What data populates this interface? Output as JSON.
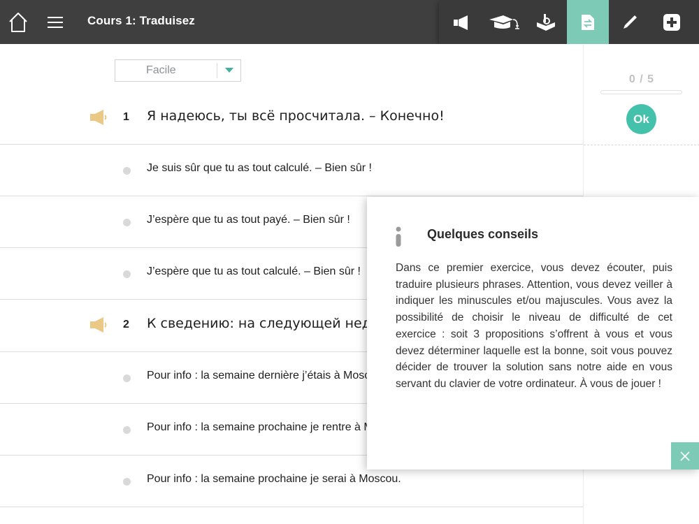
{
  "header": {
    "title": "Cours 1: Traduisez",
    "tools": [
      {
        "name": "megaphone-icon",
        "active": false
      },
      {
        "name": "graduation-cap-icon",
        "active": false
      },
      {
        "name": "book-icon",
        "active": false
      },
      {
        "name": "translate-document-icon",
        "active": true
      },
      {
        "name": "pencil-icon",
        "active": false
      },
      {
        "name": "add-icon",
        "active": false
      }
    ]
  },
  "difficulty": {
    "selected": "Facile"
  },
  "questions": [
    {
      "number": "1",
      "text": "Я надеюсь, ты всё просчитала. – Конечно!",
      "answers": [
        "Je suis sûr que tu as tout calculé. – Bien sûr !",
        "J’espère que tu as tout payé. – Bien sûr !",
        "J’espère que tu as tout calculé. – Bien sûr !"
      ]
    },
    {
      "number": "2",
      "text": "К сведению: на следующей неде",
      "answers": [
        "Pour info : la semaine dernière j’étais à Mosco",
        "Pour info : la semaine prochaine je rentre à M",
        "Pour info : la semaine prochaine je serai à Moscou."
      ]
    }
  ],
  "score": {
    "text": "0 / 5",
    "progress": 0,
    "ok_label": "Ok"
  },
  "popup": {
    "title": "Quelques conseils",
    "body": "Dans ce premier exercice, vous devez écouter, puis traduire plusieurs phrases. Attention, vous devez veiller à indiquer les minuscules et/ou majuscules. Vous avez la possibilité de choisir le niveau de difficulté de cet exercice : soit 3 propositions s’offrent à vous et vous devez déterminer laquelle est la bonne, soit vous pouvez décider de trouver la solution sans notre aide en vous servant du clavier de votre ordinateur. À vous de jouer !"
  },
  "colors": {
    "topbar": "#3f3f3f",
    "accent": "#7dcbb7",
    "ok_button": "#43c1aa",
    "speaker": "#e9c985"
  }
}
